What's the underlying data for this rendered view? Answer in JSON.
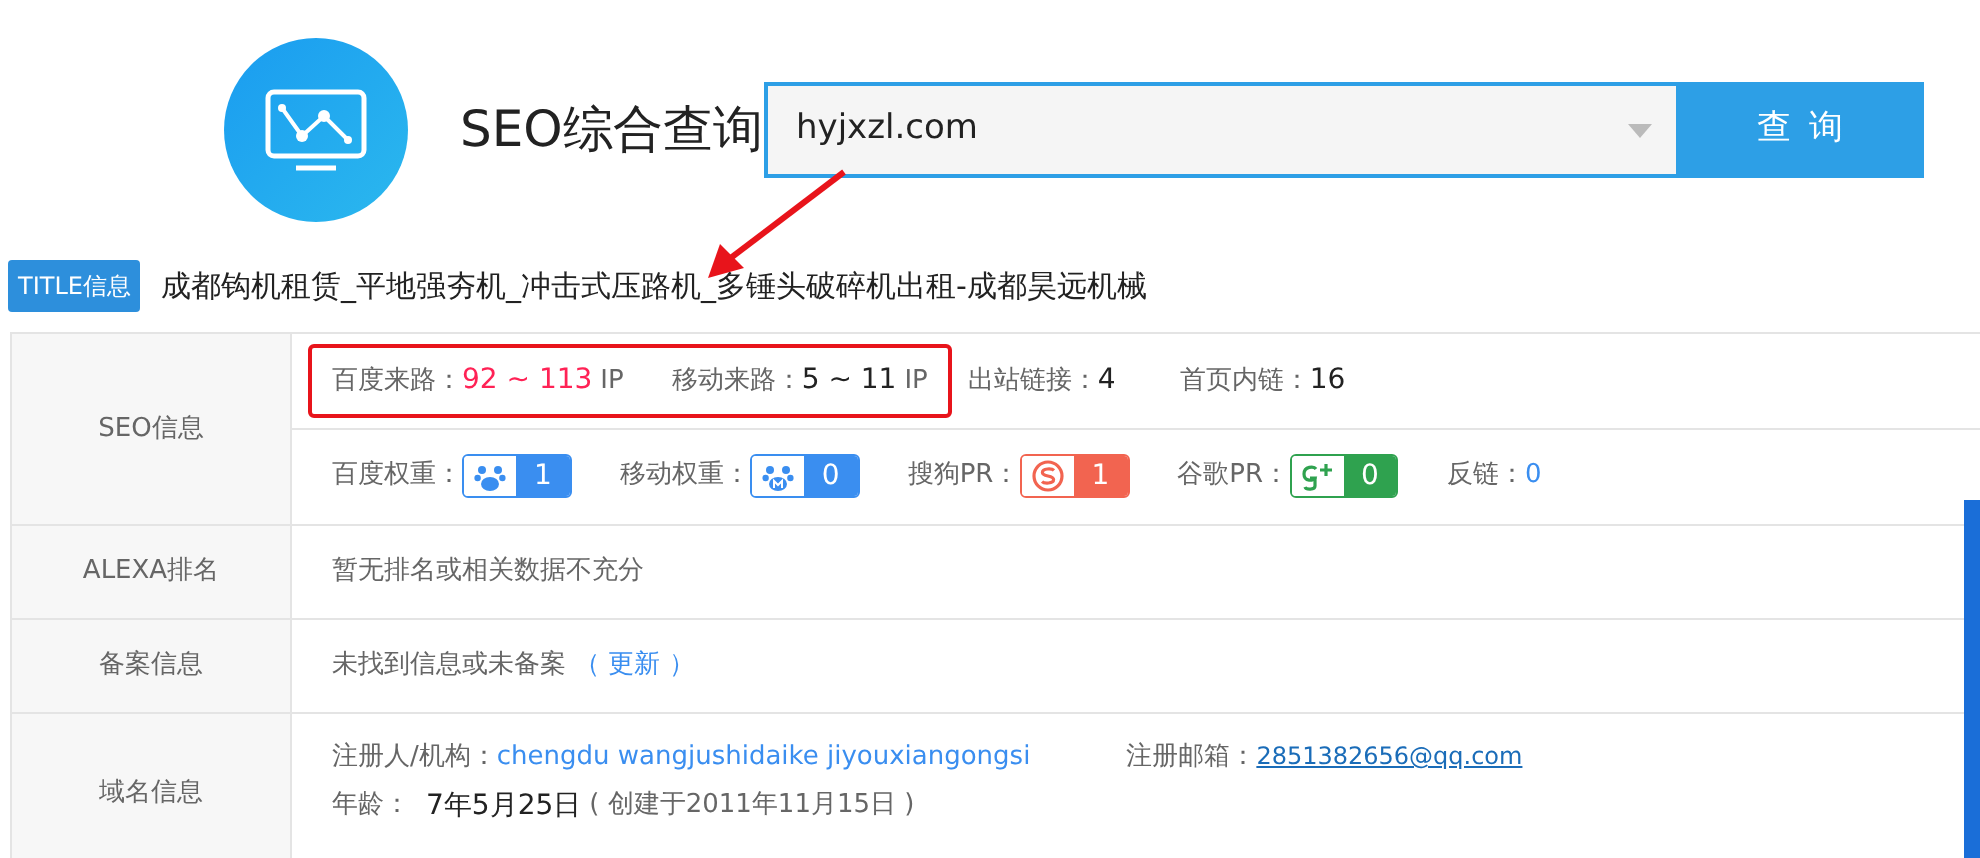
{
  "header": {
    "title": "SEO综合查询",
    "search": {
      "value": "hyjxzl.com"
    },
    "button": "查 询"
  },
  "title_info": {
    "badge": "TITLE信息",
    "text": "成都钩机租赁_平地强夯机_冲击式压路机_多锤头破碎机出租-成都昊远机械"
  },
  "annotations": {
    "arrow": true
  },
  "rows": [
    {
      "kind": "seo",
      "label": "SEO信息",
      "traffic_boxed": true,
      "traffic": [
        {
          "label": "百度来路：",
          "value": "92 ~ 113",
          "unit": "IP",
          "color": "#ff2255"
        },
        {
          "label": "移动来路：",
          "value": "5 ~ 11",
          "unit": "IP",
          "color": "#222222"
        }
      ],
      "stats": [
        {
          "label": "出站链接：",
          "value": "4"
        },
        {
          "label": "首页内链：",
          "value": "16"
        }
      ],
      "weights": [
        {
          "label": "百度权重：",
          "value": "1",
          "kind": "paw",
          "color": "#3a8ef0"
        },
        {
          "label": "移动权重：",
          "value": "0",
          "kind": "paw-mobile",
          "color": "#3a8ef0"
        },
        {
          "label": "搜狗PR：",
          "value": "1",
          "kind": "sogou",
          "color": "#f26450"
        },
        {
          "label": "谷歌PR：",
          "value": "0",
          "kind": "google",
          "color": "#2fa24f"
        }
      ],
      "backlink": {
        "label": "反链：",
        "value": "0"
      }
    },
    {
      "kind": "text",
      "label": "ALEXA排名",
      "text": "暂无排名或相关数据不充分"
    },
    {
      "kind": "text",
      "label": "备案信息",
      "text": "未找到信息或未备案",
      "link": "（ 更新 ）"
    },
    {
      "kind": "domain",
      "label": "域名信息",
      "owner": {
        "label": "注册人/机构：",
        "value": "chengdu wangjushidaike jiyouxiangongsi"
      },
      "email": {
        "label": "注册邮箱：",
        "value": "2851382656@qq.com "
      },
      "age": {
        "label": "年龄：",
        "value": "7年5月25日",
        "note": "( 创建于2011年11月15日 )"
      }
    }
  ]
}
